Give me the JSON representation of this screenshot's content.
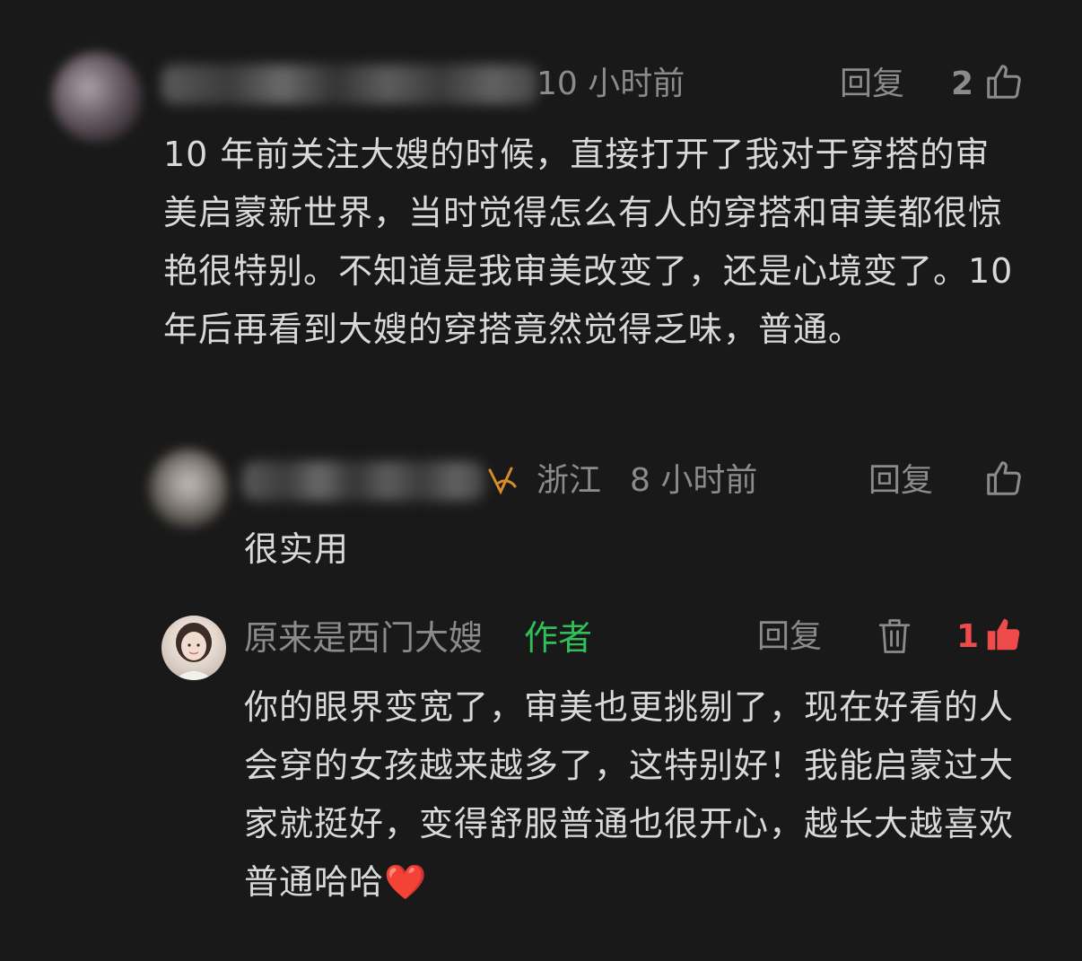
{
  "comments": [
    {
      "time": "10 小时前",
      "reply_label": "回复",
      "like_count": "2",
      "text": "10 年前关注大嫂的时候，直接打开了我对于穿搭的审美启蒙新世界，当时觉得怎么有人的穿搭和审美都很惊艳很特别。不知道是我审美改变了，还是心境变了。10 年后再看到大嫂的穿搭竟然觉得乏味，普通。"
    },
    {
      "location": "浙江",
      "time": "8 小时前",
      "reply_label": "回复",
      "text": "很实用"
    },
    {
      "author": "原来是西门大嫂",
      "author_tag": "作者",
      "reply_label": "回复",
      "like_count": "1",
      "text": "你的眼界变宽了，审美也更挑剔了，现在好看的人会穿的女孩越来越多了，这特别好！我能启蒙过大家就挺好，变得舒服普通也很开心，越长大越喜欢普通哈哈❤️"
    }
  ],
  "colors": {
    "background": "#191919",
    "meta_text": "#8b8b8b",
    "body_text": "#d9d9d9",
    "author_tag": "#2fbf5b",
    "liked": "#f04b4b",
    "vip_badge": "#d98a2b"
  },
  "icons": {
    "like": "thumbs-up-icon",
    "liked": "thumbs-up-filled-icon",
    "delete": "trash-icon",
    "badge": "vip-badge-icon"
  }
}
